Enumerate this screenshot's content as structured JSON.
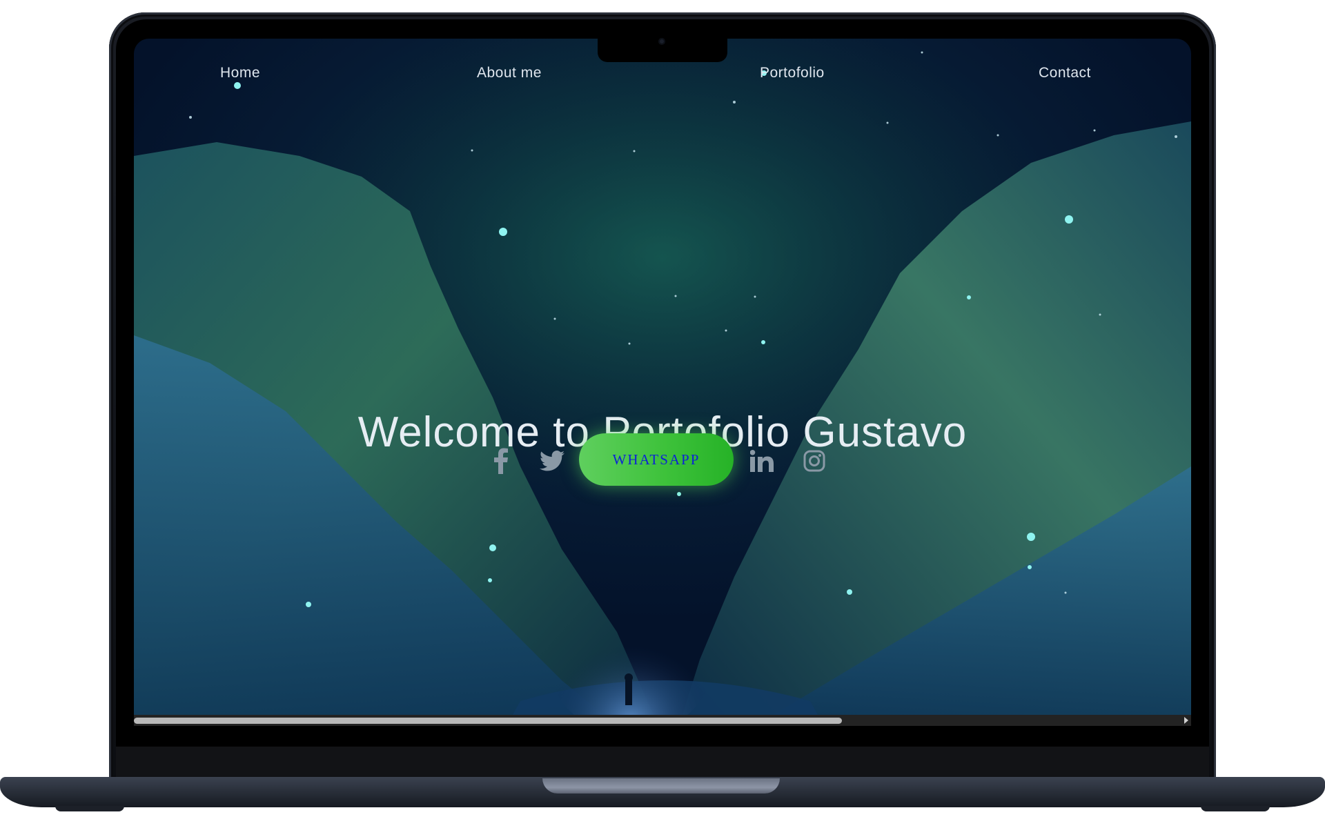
{
  "nav": {
    "items": [
      {
        "label": "Home"
      },
      {
        "label": "About me"
      },
      {
        "label": "Portofolio"
      },
      {
        "label": "Contact"
      }
    ]
  },
  "hero": {
    "title": "Welcome to Portofolio Gustavo"
  },
  "social": {
    "whatsapp_label": "WHATSAPP",
    "icons": [
      "facebook-icon",
      "twitter-icon",
      "whatsapp-button",
      "linkedin-icon",
      "instagram-icon"
    ],
    "icon_color": "#8a99a6",
    "whatsapp_color": "#3ec23b",
    "whatsapp_text_color": "#0c22d6"
  },
  "scrollbar": {
    "horizontal_position_fraction": 0.67
  },
  "colors": {
    "nav_text": "#dfe6ee",
    "title_text": "#e6edf3",
    "sky": "#061a33"
  }
}
